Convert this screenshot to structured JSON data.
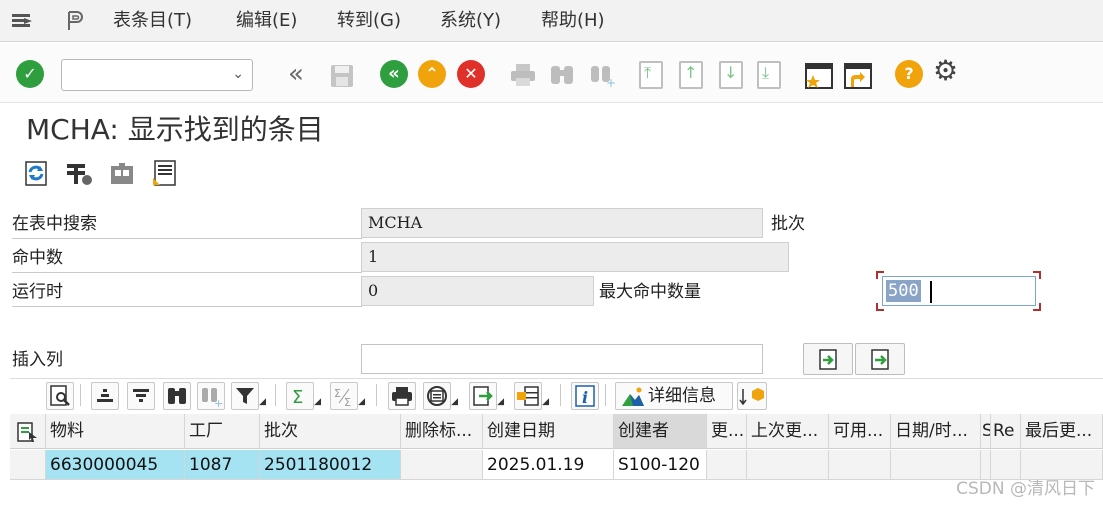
{
  "menu": {
    "items": [
      {
        "label": "表条目(T)"
      },
      {
        "label": "编辑(E)"
      },
      {
        "label": "转到(G)"
      },
      {
        "label": "系统(Y)"
      },
      {
        "label": "帮助(H)"
      }
    ]
  },
  "toolbar": {
    "command_field_value": "",
    "icons": [
      "enter-icon",
      "save-icon",
      "back-icon",
      "exit-icon",
      "cancel-icon",
      "print-icon",
      "find-icon",
      "find-next-icon",
      "first-page-icon",
      "prev-page-icon",
      "next-page-icon",
      "last-page-icon",
      "new-session-icon",
      "shortcut-icon",
      "help-icon",
      "settings-icon"
    ]
  },
  "title": "MCHA: 显示找到的条目",
  "form": {
    "search_table_label": "在表中搜索",
    "search_table_value": "MCHA",
    "search_table_desc": "批次",
    "hits_label": "命中数",
    "hits_value": "1",
    "runtime_label": "运行时",
    "runtime_value": "0",
    "max_hits_label": "最大命中数量",
    "max_hits_value": "500",
    "insert_column_label": "插入列",
    "insert_column_value": ""
  },
  "alv": {
    "detail_label": "详细信息"
  },
  "grid": {
    "columns": [
      "物料",
      "工厂",
      "批次",
      "删除标...",
      "创建日期",
      "创建者",
      "更...",
      "上次更...",
      "可用...",
      "日期/时...",
      "S",
      "Re",
      "最后更..."
    ],
    "rows": [
      [
        "6630000045",
        "1087",
        "2501180012",
        "",
        "2025.01.19",
        "S100-120",
        "",
        "",
        "",
        "",
        "",
        "",
        ""
      ]
    ]
  },
  "watermark": "CSDN @清风日下",
  "colors": {
    "accent_green": "#2e9e3e",
    "accent_orange": "#f0a30a",
    "accent_red": "#e0302a",
    "row_highlight": "#a5e2f2"
  }
}
